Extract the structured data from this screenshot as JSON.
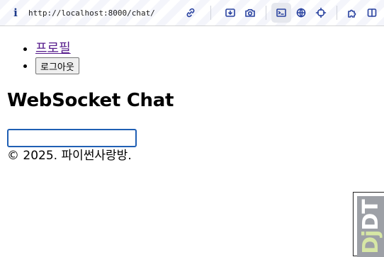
{
  "browser": {
    "url": "http://localhost:8000/chat/",
    "info_icon": "i",
    "icons": [
      "link-icon",
      "screenshot-icon",
      "camera-icon",
      "terminal-icon",
      "globe-icon",
      "crosshair-icon",
      "extensions-icon",
      "sidebar-icon"
    ],
    "accent": "#2a43a0"
  },
  "nav": {
    "profile_link": "프로필",
    "logout_button": "로그아웃"
  },
  "main": {
    "title": "WebSocket Chat",
    "input_value": ""
  },
  "footer": {
    "text": "© 2025. 파이썬사랑방."
  },
  "debug_toolbar": {
    "label_dj": "Dj",
    "label_dt": "DT"
  }
}
